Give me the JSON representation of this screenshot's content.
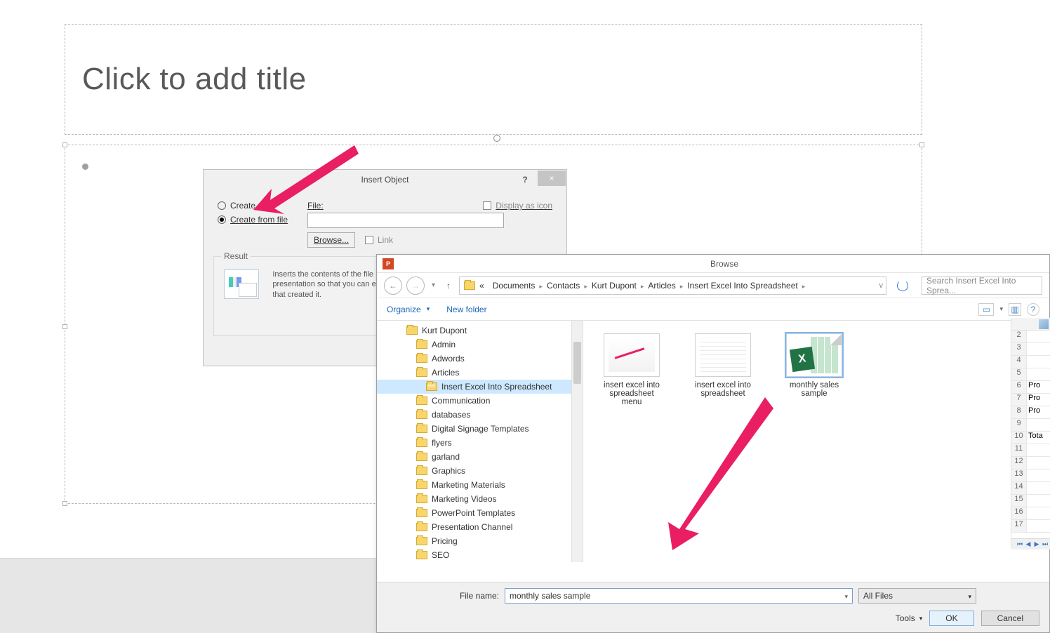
{
  "slide": {
    "title_placeholder": "Click to add title"
  },
  "insert_object": {
    "title": "Insert Object",
    "help": "?",
    "close": "×",
    "create_new": "Create new",
    "create_from_file": "Create from file",
    "file_label": "File:",
    "browse": "Browse...",
    "link": "Link",
    "display_as_icon": "Display as icon",
    "result_label": "Result",
    "result_text": "Inserts the contents of the file presentation so that you can e that created it."
  },
  "browse": {
    "app_icon": "P",
    "title": "Browse",
    "crumbs_prefix": "«",
    "crumbs": [
      "Documents",
      "Contacts",
      "Kurt Dupont",
      "Articles",
      "Insert Excel Into Spreadsheet"
    ],
    "search_placeholder": "Search Insert Excel Into Sprea...",
    "organize": "Organize",
    "new_folder": "New folder",
    "tree": [
      {
        "l": 1,
        "label": "Kurt Dupont"
      },
      {
        "l": 2,
        "label": "Admin"
      },
      {
        "l": 2,
        "label": "Adwords"
      },
      {
        "l": 2,
        "label": "Articles"
      },
      {
        "l": 3,
        "label": "Insert Excel Into Spreadsheet",
        "selected": true,
        "open": true
      },
      {
        "l": 2,
        "label": "Communication"
      },
      {
        "l": 2,
        "label": "databases"
      },
      {
        "l": 2,
        "label": "Digital Signage Templates"
      },
      {
        "l": 2,
        "label": "flyers"
      },
      {
        "l": 2,
        "label": "garland"
      },
      {
        "l": 2,
        "label": "Graphics"
      },
      {
        "l": 2,
        "label": "Marketing Materials"
      },
      {
        "l": 2,
        "label": "Marketing Videos"
      },
      {
        "l": 2,
        "label": "PowerPoint Templates"
      },
      {
        "l": 2,
        "label": "Presentation Channel"
      },
      {
        "l": 2,
        "label": "Pricing"
      },
      {
        "l": 2,
        "label": "SEO"
      }
    ],
    "files": [
      {
        "name": "insert excel into spreadsheet menu",
        "kind": "img1"
      },
      {
        "name": "insert excel into spreadsheet",
        "kind": "img2"
      },
      {
        "name": "monthly sales sample",
        "kind": "xlsx",
        "selected": true
      }
    ],
    "file_name_label": "File name:",
    "file_name_value": "monthly sales sample",
    "file_type": "All Files",
    "tools": "Tools",
    "ok": "OK",
    "cancel": "Cancel"
  },
  "preview_rows": [
    {
      "n": "2",
      "v": ""
    },
    {
      "n": "3",
      "v": ""
    },
    {
      "n": "4",
      "v": ""
    },
    {
      "n": "5",
      "v": ""
    },
    {
      "n": "6",
      "v": "Pro"
    },
    {
      "n": "7",
      "v": "Pro"
    },
    {
      "n": "8",
      "v": "Pro"
    },
    {
      "n": "9",
      "v": ""
    },
    {
      "n": "10",
      "v": "Tota"
    },
    {
      "n": "11",
      "v": ""
    },
    {
      "n": "12",
      "v": ""
    },
    {
      "n": "13",
      "v": ""
    },
    {
      "n": "14",
      "v": ""
    },
    {
      "n": "15",
      "v": ""
    },
    {
      "n": "16",
      "v": ""
    },
    {
      "n": "17",
      "v": ""
    }
  ]
}
